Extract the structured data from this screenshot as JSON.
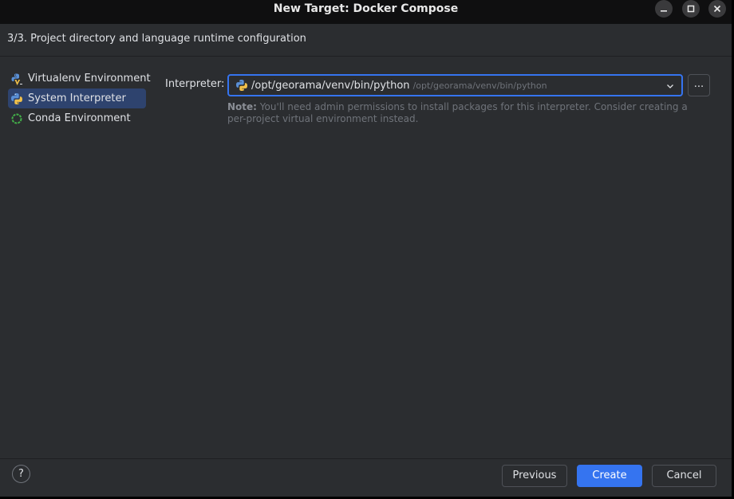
{
  "window": {
    "title": "New Target: Docker Compose"
  },
  "header": {
    "step_title": "3/3. Project directory and language runtime configuration"
  },
  "sidebar": {
    "items": [
      {
        "label": "Virtualenv Environment",
        "icon": "virtualenv-icon",
        "selected": false
      },
      {
        "label": "System Interpreter",
        "icon": "python-icon",
        "selected": true
      },
      {
        "label": "Conda Environment",
        "icon": "conda-icon",
        "selected": false
      }
    ]
  },
  "form": {
    "interpreter_label": "Interpreter:",
    "interpreter_value": "/opt/georama/venv/bin/python",
    "interpreter_path_hint": "/opt/georama/venv/bin/python",
    "browse_label": "...",
    "note_bold": "Note:",
    "note_text": " You'll need admin permissions to install packages for this interpreter. Consider creating a per-project virtual environment instead."
  },
  "footer": {
    "help_label": "?",
    "previous_label": "Previous",
    "create_label": "Create",
    "cancel_label": "Cancel"
  },
  "colors": {
    "background": "#2b2d30",
    "titlebar": "#0f0f10",
    "accent": "#3574f0",
    "selection": "#2e436e",
    "hint_text": "#6f737a"
  }
}
